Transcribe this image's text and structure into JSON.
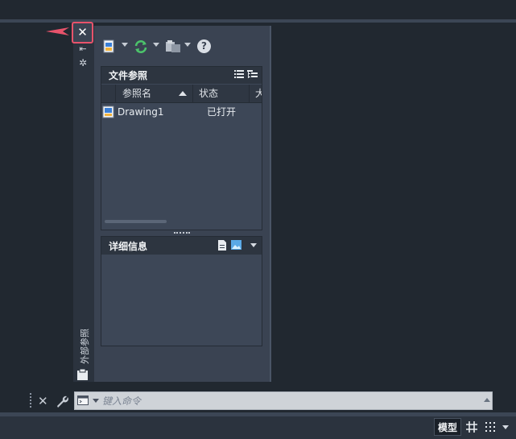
{
  "palette": {
    "title": "外部参照",
    "close_symbol": "✕",
    "autohide_symbol": "⇤",
    "properties_symbol": "✲",
    "toolbar": {
      "attach_icon": "attach-dwg-icon",
      "refresh_icon": "refresh-icon",
      "change_path_icon": "change-path-icon",
      "help_symbol": "?"
    },
    "file_references": {
      "title": "文件参照",
      "columns": [
        "参照名",
        "状态",
        "大"
      ],
      "rows": [
        {
          "name": "Drawing1",
          "status": "已打开"
        }
      ]
    },
    "details": {
      "title": "详细信息"
    }
  },
  "command_line": {
    "close_symbol": "✕",
    "placeholder": "键入命令"
  },
  "status_bar": {
    "model_label": "模型"
  },
  "colors": {
    "accent_highlight": "#e8536b",
    "refresh_green": "#4cc36b",
    "background": "#212830"
  }
}
